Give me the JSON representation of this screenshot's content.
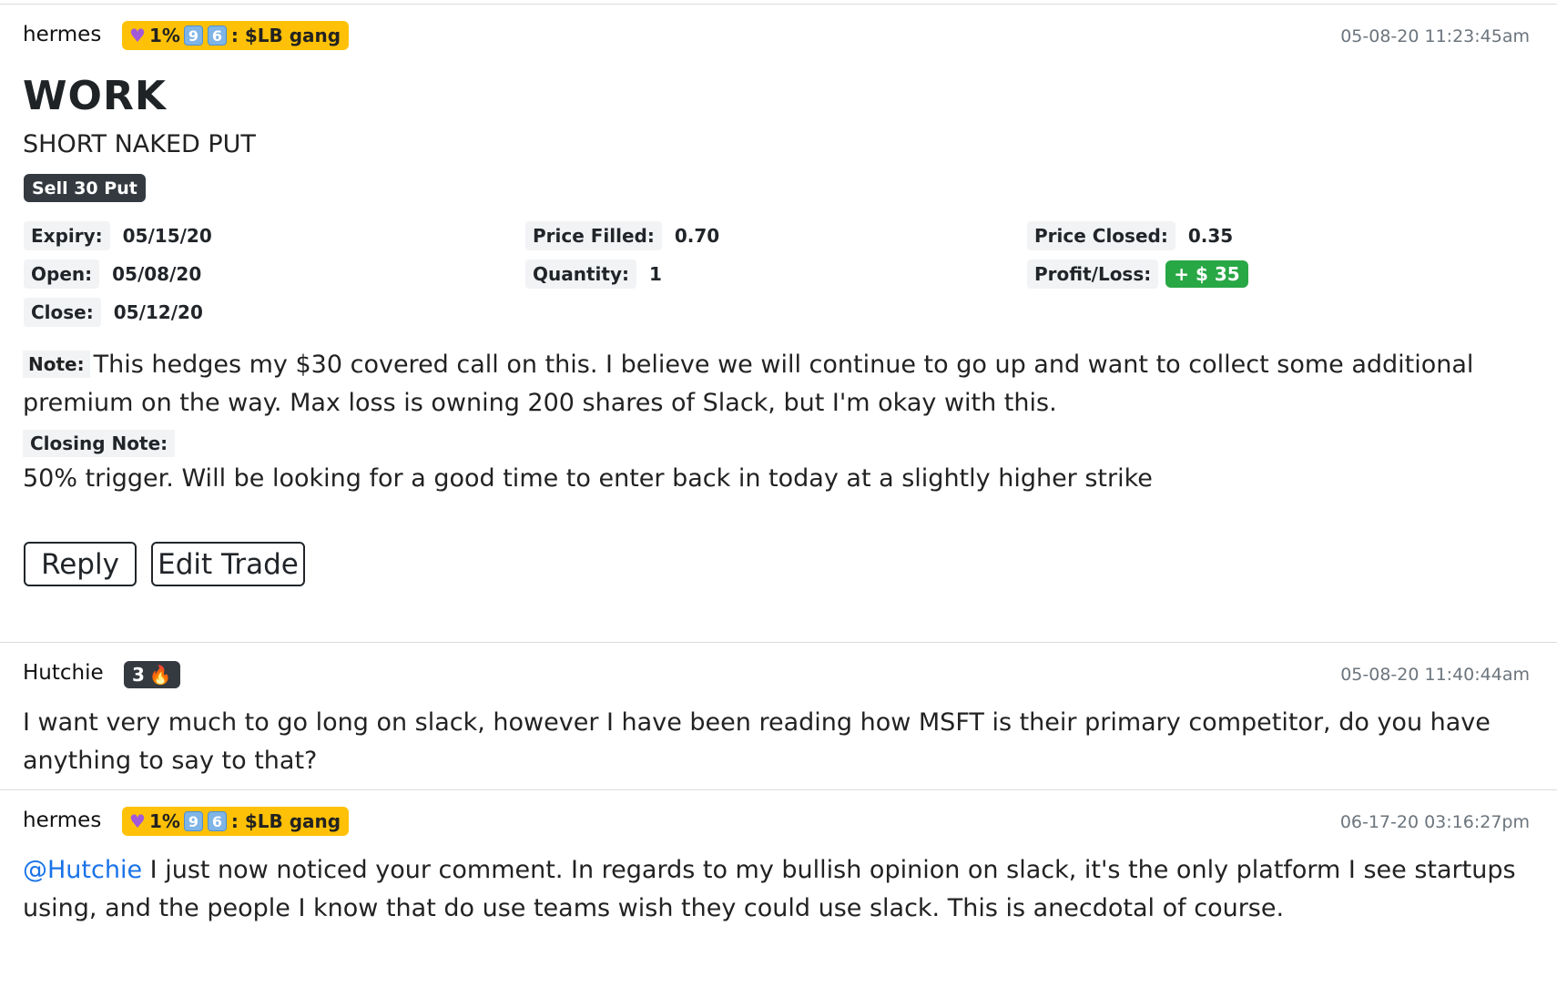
{
  "posts": [
    {
      "username": "hermes",
      "badge": {
        "heart_icon": "purple-heart",
        "text_a": "1%",
        "keycap_a": "9",
        "keycap_b": "6",
        "text_b": ": $LB gang"
      },
      "timestamp": "05-08-20 11:23:45am",
      "ticker": "WORK",
      "strategy": "SHORT NAKED PUT",
      "leg": "Sell 30 Put",
      "fields": {
        "expiry_label": "Expiry:",
        "expiry_value": "05/15/20",
        "open_label": "Open:",
        "open_value": "05/08/20",
        "close_label": "Close:",
        "close_value": "05/12/20",
        "price_filled_label": "Price Filled:",
        "price_filled_value": "0.70",
        "quantity_label": "Quantity:",
        "quantity_value": "1",
        "price_closed_label": "Price Closed:",
        "price_closed_value": "0.35",
        "pl_label": "Profit/Loss:",
        "pl_value": "+ $ 35"
      },
      "note_label": "Note:",
      "note_text": "This hedges my $30 covered call on this. I believe we will continue to go up and want to collect some additional premium on the way. Max loss is owning 200 shares of Slack, but I'm okay with this.",
      "closing_note_label": "Closing Note:",
      "closing_note_text": "50% trigger. Will be looking for a good time to enter back in today at a slightly higher strike",
      "buttons": {
        "reply": "Reply",
        "edit": "Edit Trade"
      }
    },
    {
      "username": "Hutchie",
      "badge": {
        "text": "3",
        "icon": "fire"
      },
      "timestamp": "05-08-20 11:40:44am",
      "body": "I want very much to go long on slack, however I have been reading how MSFT is their primary competitor, do you have anything to say to that?"
    },
    {
      "username": "hermes",
      "badge": {
        "heart_icon": "purple-heart",
        "text_a": "1%",
        "keycap_a": "9",
        "keycap_b": "6",
        "text_b": ": $LB gang"
      },
      "timestamp": "06-17-20 03:16:27pm",
      "mention": "@Hutchie",
      "body": " I just now noticed your comment. In regards to my bullish opinion on slack, it's the only platform I see startups using, and the people I know that do use teams wish they could use slack. This is anecdotal of course."
    }
  ],
  "colors": {
    "gang_badge": "#ffc107",
    "dark_badge": "#343a40",
    "profit": "#28a745",
    "mention": "#1a73e8"
  }
}
